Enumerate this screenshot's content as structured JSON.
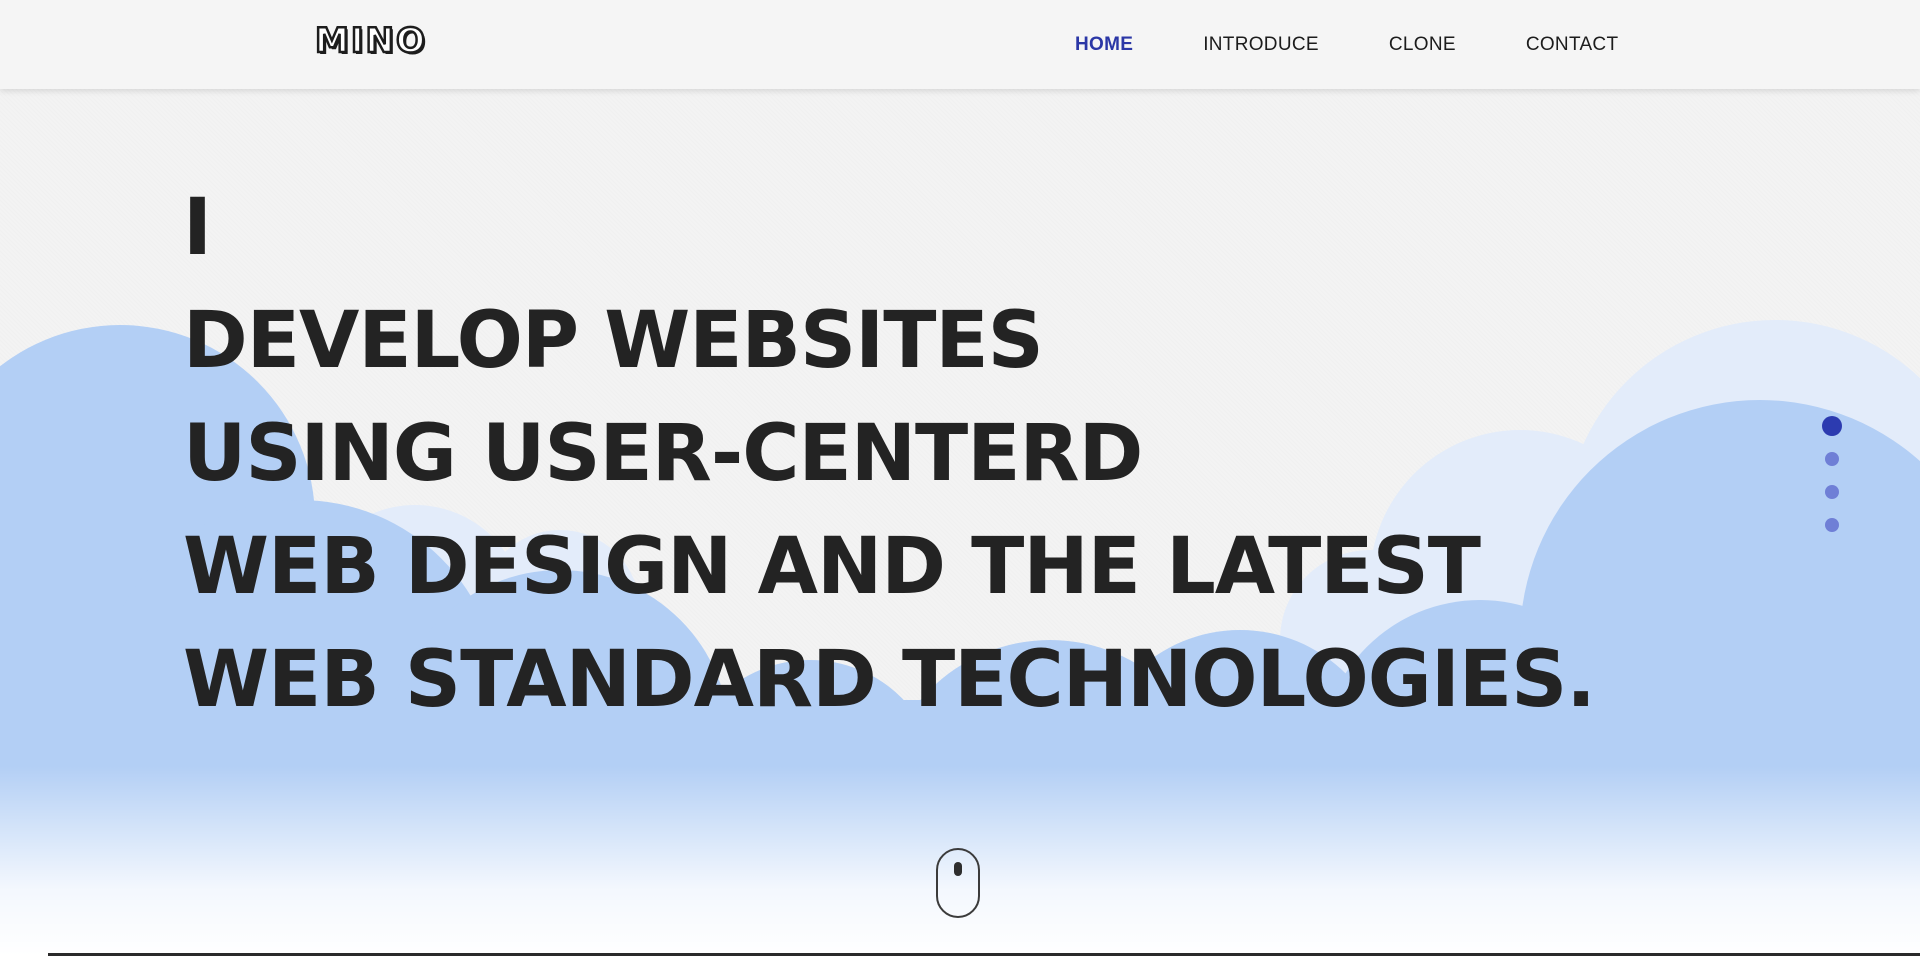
{
  "header": {
    "logo_text": "MINO",
    "nav": [
      {
        "label": "HOME",
        "active": true
      },
      {
        "label": "INTRODUCE",
        "active": false
      },
      {
        "label": "CLONE",
        "active": false
      },
      {
        "label": "CONTACT",
        "active": false
      }
    ]
  },
  "hero": {
    "lines": [
      "I",
      "DEVELOP WEBSITES",
      "USING USER-CENTERD",
      "WEB DESIGN AND THE LATEST",
      "WEB STANDARD TECHNOLOGIES."
    ]
  },
  "pager": {
    "total": 4,
    "active_index": 0
  },
  "scroll_indicator": {
    "icon": "mouse-scroll-icon"
  },
  "colors": {
    "accent": "#2c3bb0",
    "dot_inactive": "#6f7fd6",
    "cloud_front": "#b3cff5",
    "cloud_back": "#e5eefb",
    "text_dark": "#232323"
  }
}
